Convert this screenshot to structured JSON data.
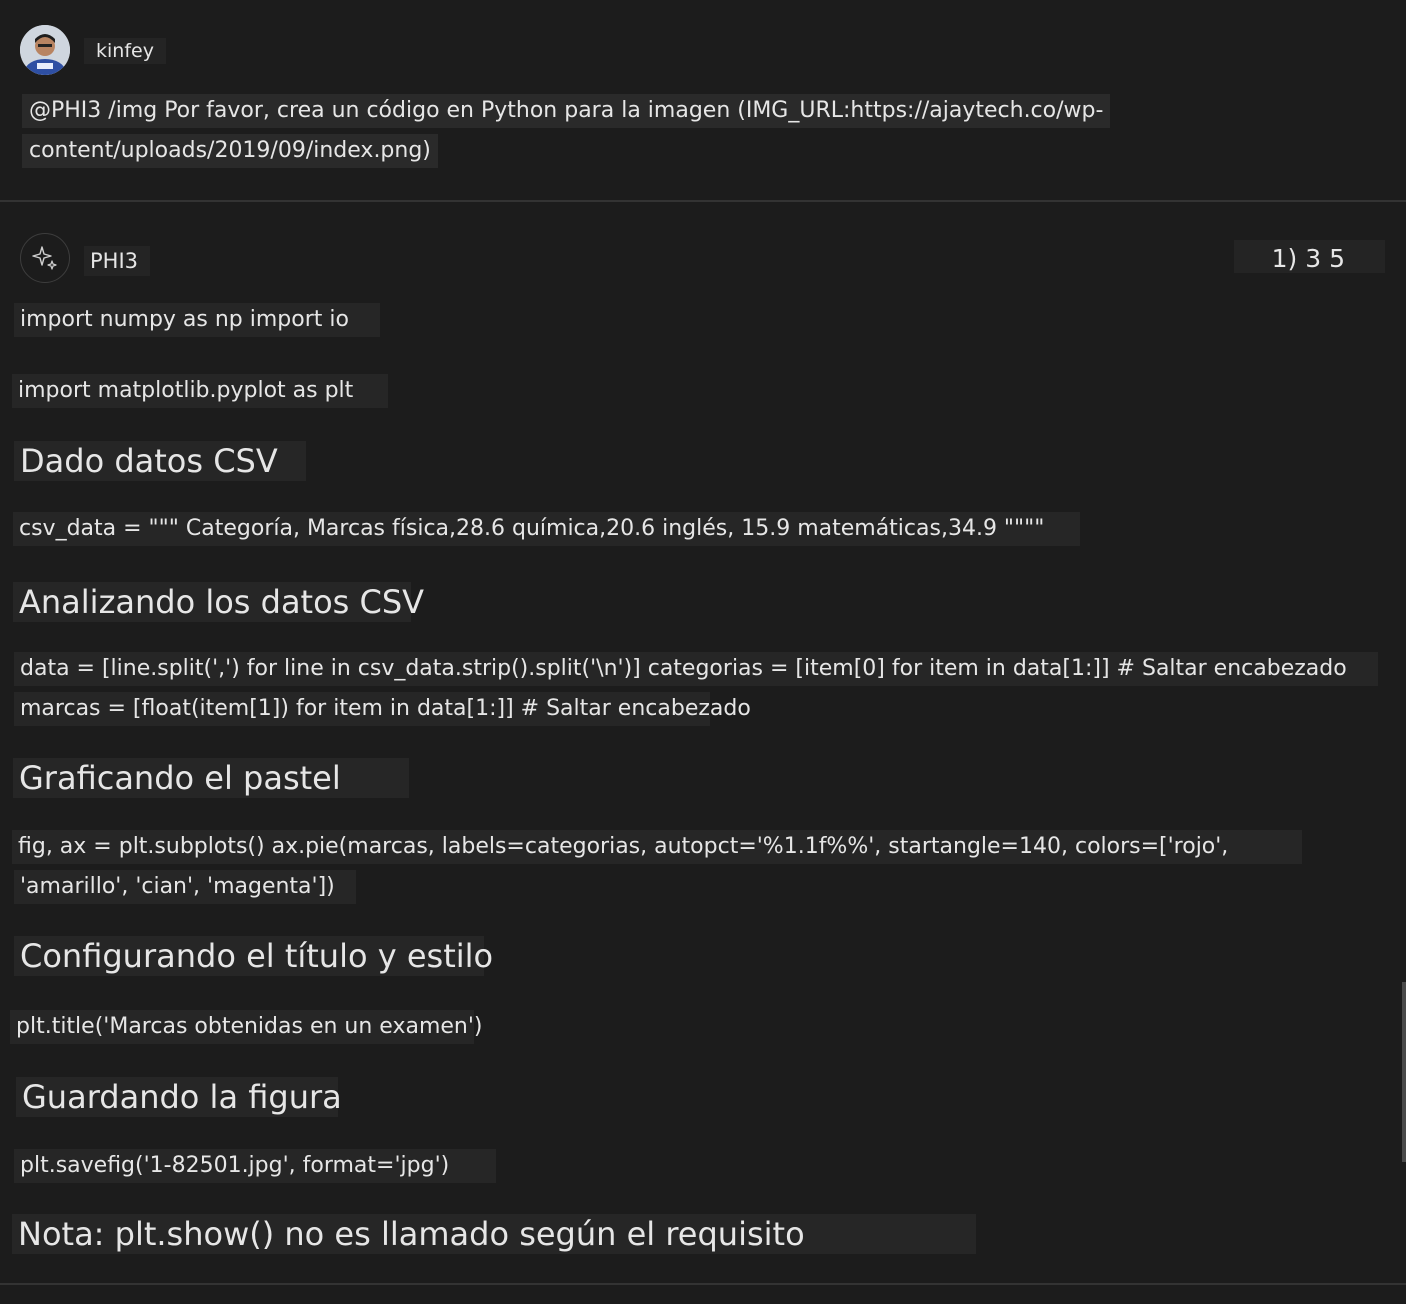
{
  "user": {
    "name": "kinfey",
    "prompt_line1": "@PHI3 /img Por favor, crea un código en Python para la imagen (IMG_URL:https://ajaytech.co/wp-",
    "prompt_line2": "content/uploads/2019/09/index.png)"
  },
  "bot": {
    "name": "PHI3",
    "counter": "1) 3 5"
  },
  "response": {
    "line1": "import numpy as np import io",
    "line2": "import matplotlib.pyplot as plt",
    "h1": "Dado datos CSV",
    "line3": "csv_data = \"\"\" Categoría, Marcas física,28.6 química,20.6 inglés, 15.9 matemáticas,34.9 \"\"\"\"",
    "h2": "Analizando los datos CSV",
    "line4": "data = [line.split(',') for line in csv_data.strip().split('\\n')] categorias = [item[0] for item in data[1:]] # Saltar encabezado",
    "line5": "marcas = [float(item[1]) for item in data[1:]] # Saltar encabezado",
    "h3": "Graficando el pastel",
    "line6": "fig, ax = plt.subplots() ax.pie(marcas, labels=categorias, autopct='%1.1f%%', startangle=140, colors=['rojo',",
    "line7": "'amarillo', 'cian', 'magenta'])",
    "h4": "Configurando el título y estilo",
    "line8": "plt.title('Marcas obtenidas en un examen')",
    "h5": "Guardando la figura",
    "line9": "plt.savefig('1-82501.jpg', format='jpg')",
    "note": "Nota: plt.show() no es llamado según el requisito"
  },
  "colors": {
    "background": "#1c1c1c",
    "text": "#e6e6e6",
    "highlight": "#262626",
    "divider": "#333333"
  },
  "icons": {
    "bot_avatar": "sparkle-icon",
    "user_avatar": "user-photo"
  }
}
